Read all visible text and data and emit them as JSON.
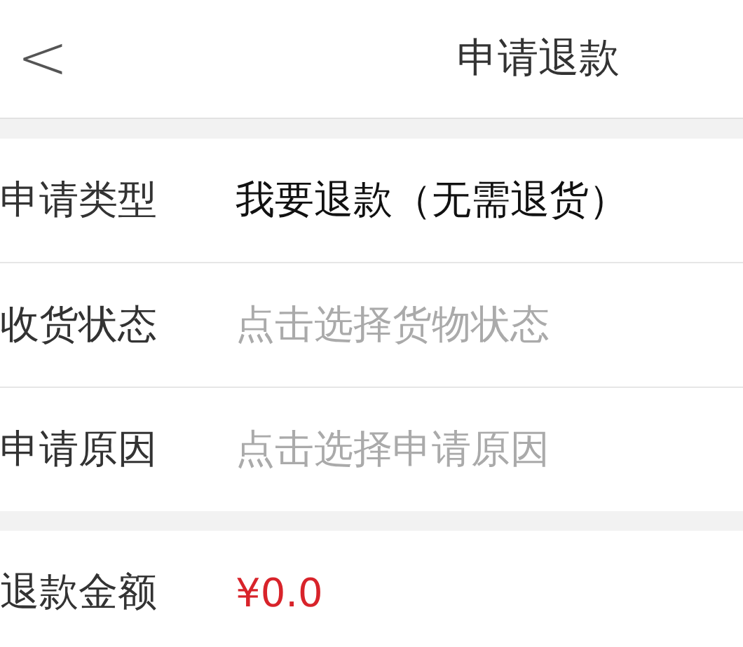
{
  "header": {
    "back": "<",
    "title": "申请退款"
  },
  "groups": [
    {
      "rows": [
        {
          "label": "申请类型",
          "kind": "text",
          "value": "我要退款（无需退货）"
        },
        {
          "label": "收货状态",
          "kind": "select",
          "placeholder": "点击选择货物状态"
        },
        {
          "label": "申请原因",
          "kind": "select",
          "placeholder": "点击选择申请原因"
        }
      ]
    },
    {
      "rows": [
        {
          "label": "退款金额",
          "kind": "amount",
          "value": "¥0.0"
        }
      ]
    }
  ]
}
